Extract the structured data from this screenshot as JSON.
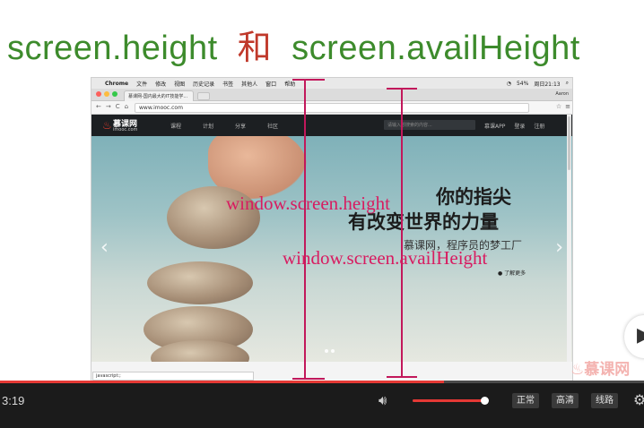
{
  "slide": {
    "title_left": "screen.height",
    "title_sep": "和",
    "title_right": "screen.availHeight"
  },
  "screenshot": {
    "mac_menu": {
      "apple": "",
      "app": "Chrome",
      "items": [
        "文件",
        "修改",
        "视图",
        "历史记录",
        "书签",
        "其他人",
        "窗口",
        "帮助"
      ],
      "status_right": [
        "54%",
        "周日21:13"
      ]
    },
    "browser": {
      "tab_title": "慕课网-国内最大的IT技能学...",
      "profile": "Aaron",
      "nav_back": "←",
      "nav_forward": "→",
      "nav_reload": "C",
      "nav_home": "⌂",
      "url": "www.imooc.com",
      "status_text": "javascript:;"
    },
    "site": {
      "logo_cn": "慕课网",
      "logo_en": "imooc.com",
      "nav": [
        "课程",
        "计划",
        "分享",
        "社区"
      ],
      "search_placeholder": "请输入想搜索的内容...",
      "right": [
        "慕课APP",
        "登录",
        "注册"
      ],
      "hero_line1": "你的指尖",
      "hero_line2": "有改变世界的力量",
      "hero_sub": "慕课网，程序员的梦工厂",
      "hero_more": "了解更多"
    }
  },
  "annotations": {
    "screen_height": "window.screen.height",
    "avail_height": "window.screen.availHeight",
    "color": "#d81b60"
  },
  "watermark": "慕课网",
  "player": {
    "time": "3:19",
    "progress": 0.69,
    "volume": 0.98,
    "buttons": [
      "正常",
      "高清",
      "线路"
    ],
    "accent": "#e53935"
  }
}
